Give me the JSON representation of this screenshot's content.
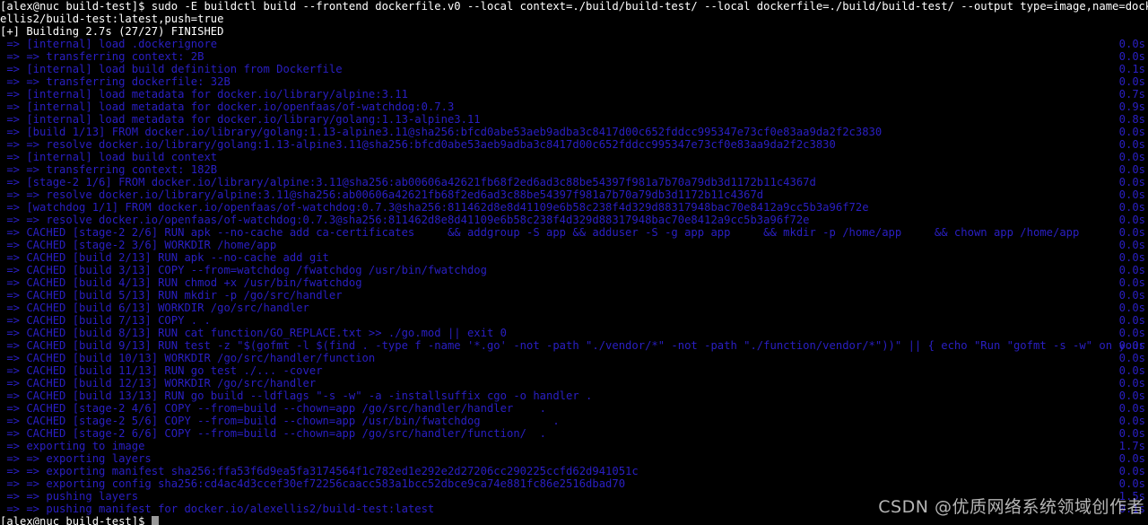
{
  "terminal": {
    "background_color": "#000000",
    "prompt_color": "#ffffff",
    "output_color": "#2a1fc4",
    "cursor_color": "#9a9a9a",
    "command_line_1": "[alex@nuc build-test]$ sudo -E buildctl build --frontend dockerfile.v0 --local context=./build/build-test/ --local dockerfile=./build/build-test/ --output type=image,name=docker.io/alex",
    "command_line_2": "ellis2/build-test:latest,push=true",
    "status_line": "[+] Building 2.7s (27/27) FINISHED",
    "final_prompt": "[alex@nuc build-test]$ ",
    "lines": [
      {
        "text": " => [internal] load .dockerignore",
        "time": "0.0s"
      },
      {
        "text": " => => transferring context: 2B",
        "time": "0.0s"
      },
      {
        "text": " => [internal] load build definition from Dockerfile",
        "time": "0.1s"
      },
      {
        "text": " => => transferring dockerfile: 32B",
        "time": "0.0s"
      },
      {
        "text": " => [internal] load metadata for docker.io/library/alpine:3.11",
        "time": "0.7s"
      },
      {
        "text": " => [internal] load metadata for docker.io/openfaas/of-watchdog:0.7.3",
        "time": "0.9s"
      },
      {
        "text": " => [internal] load metadata for docker.io/library/golang:1.13-alpine3.11",
        "time": "0.8s"
      },
      {
        "text": " => [build 1/13] FROM docker.io/library/golang:1.13-alpine3.11@sha256:bfcd0abe53aeb9adba3c8417d00c652fddcc995347e73cf0e83aa9da2f2c3830",
        "time": "0.0s"
      },
      {
        "text": " => => resolve docker.io/library/golang:1.13-alpine3.11@sha256:bfcd0abe53aeb9adba3c8417d00c652fddcc995347e73cf0e83aa9da2f2c3830",
        "time": "0.0s"
      },
      {
        "text": " => [internal] load build context",
        "time": "0.0s"
      },
      {
        "text": " => => transferring context: 182B",
        "time": "0.0s"
      },
      {
        "text": " => [stage-2 1/6] FROM docker.io/library/alpine:3.11@sha256:ab00606a42621fb68f2ed6ad3c88be54397f981a7b70a79db3d1172b11c4367d",
        "time": "0.0s"
      },
      {
        "text": " => => resolve docker.io/library/alpine:3.11@sha256:ab00606a42621fb68f2ed6ad3c88be54397f981a7b70a79db3d1172b11c4367d",
        "time": "0.0s"
      },
      {
        "text": " => [watchdog 1/1] FROM docker.io/openfaas/of-watchdog:0.7.3@sha256:811462d8e8d41109e6b58c238f4d329d88317948bac70e8412a9cc5b3a96f72e",
        "time": "0.0s"
      },
      {
        "text": " => => resolve docker.io/openfaas/of-watchdog:0.7.3@sha256:811462d8e8d41109e6b58c238f4d329d88317948bac70e8412a9cc5b3a96f72e",
        "time": "0.0s"
      },
      {
        "text": " => CACHED [stage-2 2/6] RUN apk --no-cache add ca-certificates     && addgroup -S app && adduser -S -g app app     && mkdir -p /home/app     && chown app /home/app",
        "time": "0.0s"
      },
      {
        "text": " => CACHED [stage-2 3/6] WORKDIR /home/app",
        "time": "0.0s"
      },
      {
        "text": " => CACHED [build 2/13] RUN apk --no-cache add git",
        "time": "0.0s"
      },
      {
        "text": " => CACHED [build 3/13] COPY --from=watchdog /fwatchdog /usr/bin/fwatchdog",
        "time": "0.0s"
      },
      {
        "text": " => CACHED [build 4/13] RUN chmod +x /usr/bin/fwatchdog",
        "time": "0.0s"
      },
      {
        "text": " => CACHED [build 5/13] RUN mkdir -p /go/src/handler",
        "time": "0.0s"
      },
      {
        "text": " => CACHED [build 6/13] WORKDIR /go/src/handler",
        "time": "0.0s"
      },
      {
        "text": " => CACHED [build 7/13] COPY . .",
        "time": "0.0s"
      },
      {
        "text": " => CACHED [build 8/13] RUN cat function/GO_REPLACE.txt >> ./go.mod || exit 0",
        "time": "0.0s"
      },
      {
        "text": " => CACHED [build 9/13] RUN test -z \"$(gofmt -l $(find . -type f -name '*.go' -not -path \"./vendor/*\" -not -path \"./function/vendor/*\"))\" || { echo \"Run \"gofmt -s -w\" on your Gol",
        "time": "0.0s"
      },
      {
        "text": " => CACHED [build 10/13] WORKDIR /go/src/handler/function",
        "time": "0.0s"
      },
      {
        "text": " => CACHED [build 11/13] RUN go test ./... -cover",
        "time": "0.0s"
      },
      {
        "text": " => CACHED [build 12/13] WORKDIR /go/src/handler",
        "time": "0.0s"
      },
      {
        "text": " => CACHED [build 13/13] RUN go build --ldflags \"-s -w\" -a -installsuffix cgo -o handler .",
        "time": "0.0s"
      },
      {
        "text": " => CACHED [stage-2 4/6] COPY --from=build --chown=app /go/src/handler/handler    .",
        "time": "0.0s"
      },
      {
        "text": " => CACHED [stage-2 5/6] COPY --from=build --chown=app /usr/bin/fwatchdog           .",
        "time": "0.0s"
      },
      {
        "text": " => CACHED [stage-2 6/6] COPY --from=build --chown=app /go/src/handler/function/  .",
        "time": "0.0s"
      },
      {
        "text": " => exporting to image",
        "time": "1.7s"
      },
      {
        "text": " => => exporting layers",
        "time": "0.0s"
      },
      {
        "text": " => => exporting manifest sha256:ffa53f6d9ea5fa3174564f1c782ed1e292e2d27206cc290225ccfd62d941051c",
        "time": "0.0s"
      },
      {
        "text": " => => exporting config sha256:cd4ac4d3ccef30ef72256caacc583a1bcc52dbce9ca74e881fc86e2516dbad70",
        "time": "0.0s"
      },
      {
        "text": " => => pushing layers",
        "time": "1.5s"
      },
      {
        "text": " => => pushing manifest for docker.io/alexellis2/build-test:latest",
        "time": "0.1s"
      }
    ]
  },
  "watermark": {
    "text": "CSDN @优质网络系统领域创作者"
  }
}
